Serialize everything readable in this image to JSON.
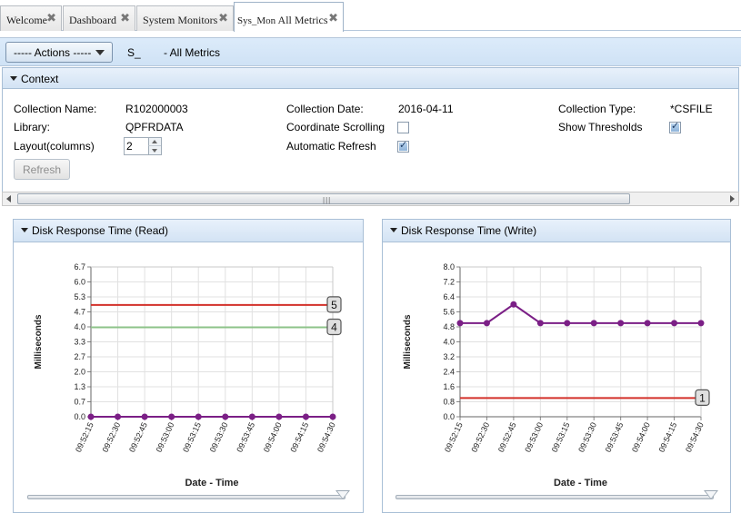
{
  "tabs": [
    {
      "label": "Welcome"
    },
    {
      "label": "Dashboard"
    },
    {
      "label": "System Monitors"
    },
    {
      "label_small": "Sys_Mon",
      "label": "All Metrics"
    }
  ],
  "toolbar": {
    "actions_label": "----- Actions -----",
    "title_prefix": "S_",
    "title": "- All Metrics"
  },
  "context": {
    "header": "Context",
    "collection_name_label": "Collection Name:",
    "collection_name": "R102000003",
    "library_label": "Library:",
    "library": "QPFRDATA",
    "layout_label": "Layout(columns)",
    "layout_value": "2",
    "collection_date_label": "Collection Date:",
    "collection_date": "2016-04-11",
    "coordinate_scrolling_label": "Coordinate Scrolling",
    "coordinate_scrolling": false,
    "automatic_refresh_label": "Automatic Refresh",
    "automatic_refresh": true,
    "collection_type_label": "Collection Type:",
    "collection_type": "*CSFILE",
    "show_thresholds_label": "Show Thresholds",
    "show_thresholds": true,
    "refresh_label": "Refresh"
  },
  "chart_data": [
    {
      "type": "line",
      "title": "Disk Response Time (Read)",
      "xlabel": "Date - Time",
      "ylabel": "Milliseconds",
      "ylim": [
        0,
        6.7
      ],
      "yticks": [
        "0.0",
        "0.7",
        "1.3",
        "2.0",
        "2.7",
        "3.3",
        "4.0",
        "4.7",
        "5.3",
        "6.0",
        "6.7"
      ],
      "categories": [
        "09:52:15",
        "09:52:30",
        "09:52:45",
        "09:53:00",
        "09:53:15",
        "09:53:30",
        "09:53:45",
        "09:54:00",
        "09:54:15",
        "09:54:30"
      ],
      "series": [
        {
          "values": [
            0,
            0,
            0,
            0,
            0,
            0,
            0,
            0,
            0,
            0
          ],
          "color": "#7b1f86"
        }
      ],
      "thresholds": [
        {
          "label": "5",
          "value": 5.0,
          "color": "#d3312a"
        },
        {
          "label": "4",
          "value": 4.0,
          "color": "#8dc389"
        }
      ],
      "grid": true
    },
    {
      "type": "line",
      "title": "Disk Response Time (Write)",
      "xlabel": "Date - Time",
      "ylabel": "Milliseconds",
      "ylim": [
        0,
        8.0
      ],
      "yticks": [
        "0.0",
        "0.8",
        "1.6",
        "2.4",
        "3.2",
        "4.0",
        "4.8",
        "5.6",
        "6.4",
        "7.2",
        "8.0"
      ],
      "categories": [
        "09:52:15",
        "09:52:30",
        "09:52:45",
        "09:53:00",
        "09:53:15",
        "09:53:30",
        "09:53:45",
        "09:54:00",
        "09:54:15",
        "09:54:30"
      ],
      "series": [
        {
          "values": [
            5.0,
            5.0,
            6.0,
            5.0,
            5.0,
            5.0,
            5.0,
            5.0,
            5.0,
            5.0
          ],
          "color": "#7b1f86"
        }
      ],
      "thresholds": [
        {
          "label": "1",
          "value": 1.0,
          "color": "#d3312a"
        }
      ],
      "grid": true
    }
  ]
}
